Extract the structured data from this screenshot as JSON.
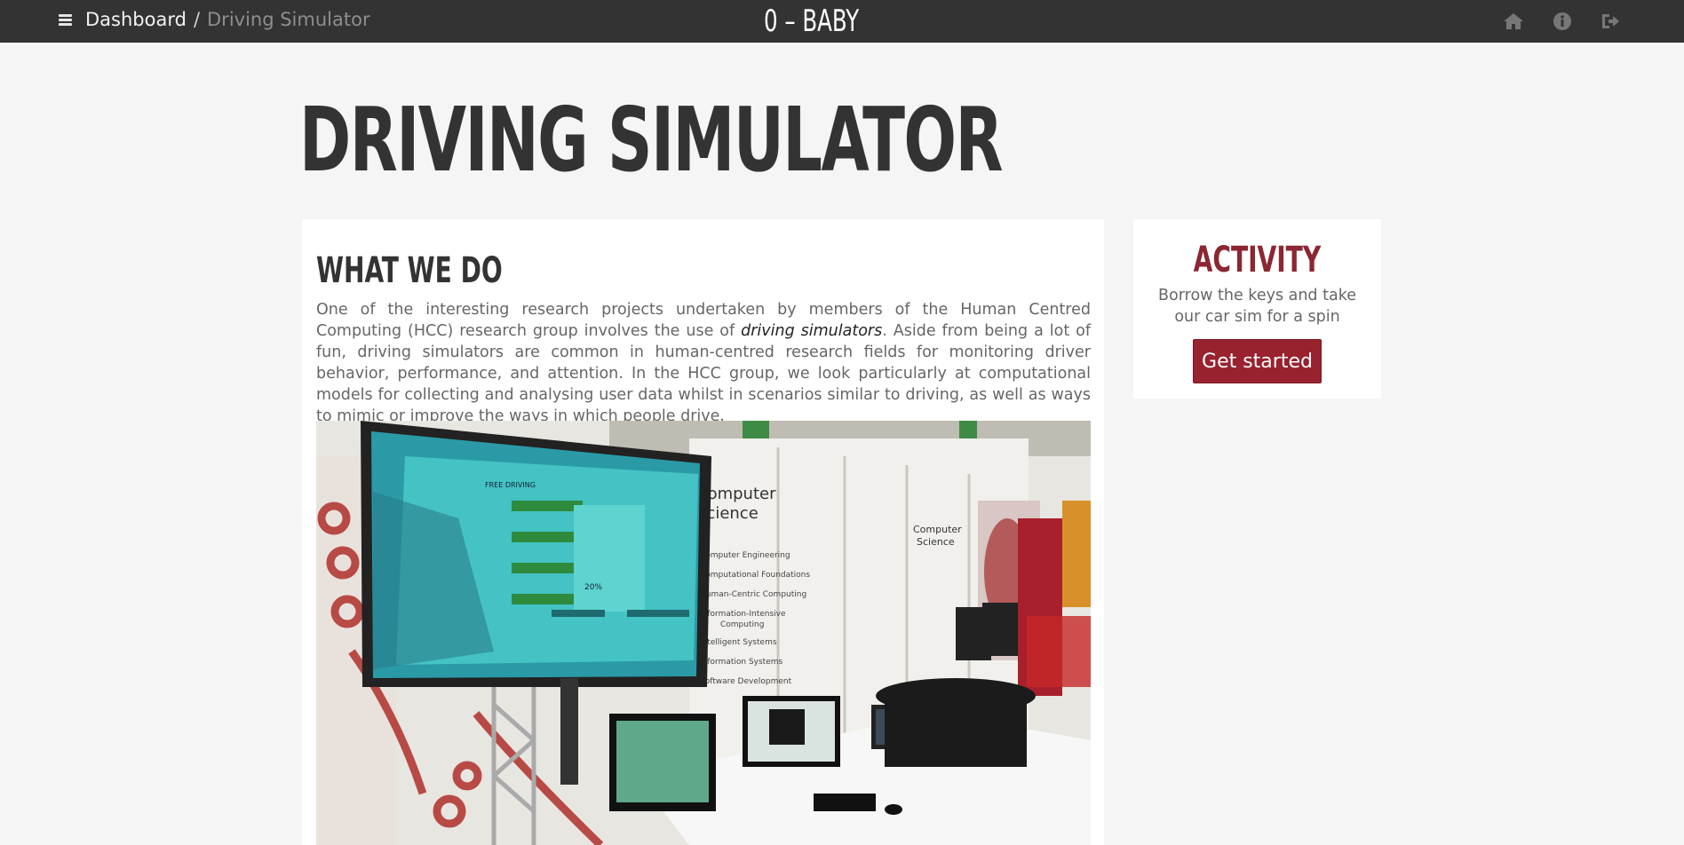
{
  "topbar": {
    "breadcrumb": {
      "root": "Dashboard",
      "separator": "/",
      "current": "Driving Simulator"
    },
    "brand": "0 – BABY",
    "icons": [
      "home-icon",
      "info-icon",
      "logout-icon"
    ]
  },
  "page": {
    "title": "DRIVING SIMULATOR"
  },
  "main": {
    "section_title": "WHAT WE DO",
    "description_part1": "One of the interesting research projects undertaken by members of the Human Centred Computing (HCC) research group involves the use of ",
    "description_emphasis": "driving simulators",
    "description_part2": ". Aside from being a lot of fun, driving simulators are common in human-centred research fields for monitoring driver behavior, performance, and attention. In the HCC group, we look particularly at computational models for collecting and analysing user data whilst in scenarios similar to driving, as well as ways to mimic or improve the ways in which people drive.",
    "photo": {
      "screen_heading": "FREE DRIVING",
      "screen_value": "20%",
      "booth_title": "Computer Science",
      "booth_items": [
        "Computer Engineering",
        "Computational Foundations",
        "Human-Centric Computing",
        "Information-Intensive Computing",
        "Intelligent Systems",
        "Information Systems",
        "Software Development"
      ]
    }
  },
  "side": {
    "title": "ACTIVITY",
    "text": "Borrow the keys and take our car sim for a spin",
    "button_label": "Get started"
  },
  "colors": {
    "topbar": "#333333",
    "accent": "#99222f",
    "background": "#f5f5f5"
  }
}
